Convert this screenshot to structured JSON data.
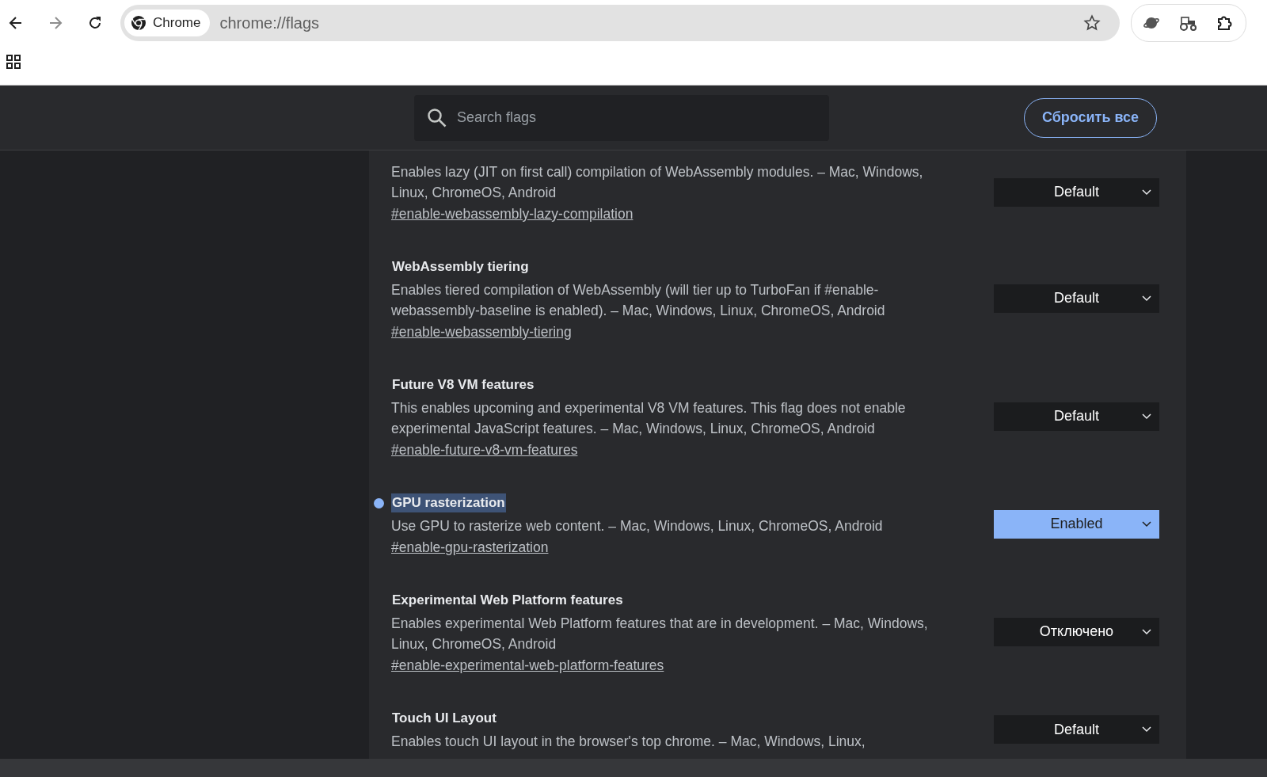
{
  "browser": {
    "chip_label": "Chrome",
    "address": "chrome://flags"
  },
  "header": {
    "search": {
      "placeholder": "Search flags"
    },
    "reset_button": "Сбросить все"
  },
  "flags": [
    {
      "description": "Enables lazy (JIT on first call) compilation of WebAssembly modules. – Mac, Windows, Linux, ChromeOS, Android",
      "link": "#enable-webassembly-lazy-compilation",
      "value": "Default",
      "modified": false
    },
    {
      "title": "WebAssembly tiering",
      "description": "Enables tiered compilation of WebAssembly (will tier up to TurboFan if #enable-webassembly-baseline is enabled). – Mac, Windows, Linux, ChromeOS, Android",
      "link": "#enable-webassembly-tiering",
      "value": "Default",
      "modified": false,
      "title_highlighted": false
    },
    {
      "title": "Future V8 VM features",
      "description": "This enables upcoming and experimental V8 VM features. This flag does not enable experimental JavaScript features. – Mac, Windows, Linux, ChromeOS, Android",
      "link": "#enable-future-v8-vm-features",
      "value": "Default",
      "modified": false,
      "title_highlighted": false
    },
    {
      "title": "GPU rasterization",
      "description": "Use GPU to rasterize web content. – Mac, Windows, Linux, ChromeOS, Android",
      "link": "#enable-gpu-rasterization",
      "value": "Enabled",
      "modified": true,
      "title_highlighted": true
    },
    {
      "title": "Experimental Web Platform features",
      "description": "Enables experimental Web Platform features that are in development. – Mac, Windows, Linux, ChromeOS, Android",
      "link": "#enable-experimental-web-platform-features",
      "value": "Отключено",
      "modified": false,
      "title_highlighted": false
    },
    {
      "title": "Touch UI Layout",
      "description": "Enables touch UI layout in the browser's top chrome. – Mac, Windows, Linux,",
      "value": "Default",
      "modified": false,
      "title_highlighted": false
    }
  ]
}
